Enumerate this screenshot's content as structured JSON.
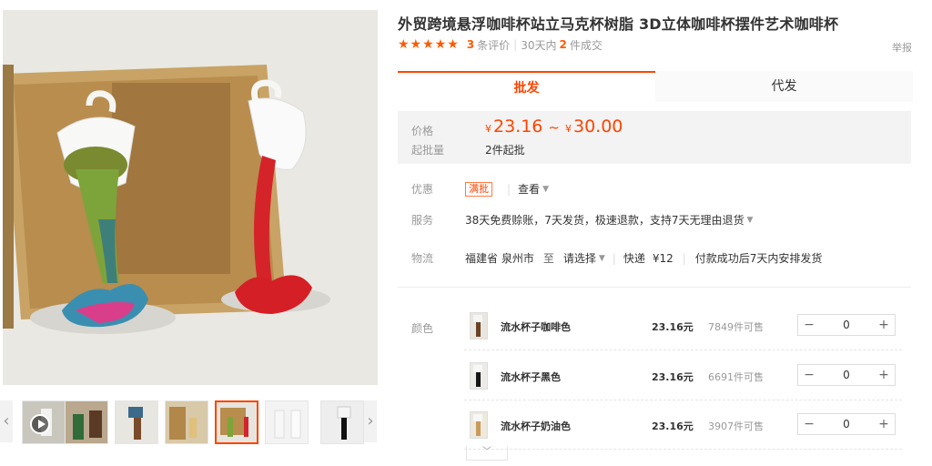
{
  "product": {
    "title": "外贸跨境悬浮咖啡杯站立马克杯树脂 3D立体咖啡杯摆件艺术咖啡杯",
    "stars": "★★★★★",
    "review_count": "3",
    "review_label": "条评价",
    "sales_prefix": "30天内",
    "sales_count": "2",
    "sales_label": "件成交",
    "report": "举报"
  },
  "tabs": [
    {
      "label": "批发"
    },
    {
      "label": "代发"
    }
  ],
  "price": {
    "label": "价格",
    "currency": "¥",
    "low": "23.16",
    "tilde": "~",
    "high": "30.00",
    "min_label": "起批量",
    "min_value": "2件起批"
  },
  "promo": {
    "label": "优惠",
    "tag": "满批",
    "view": "查看"
  },
  "service": {
    "label": "服务",
    "text": "38天免费赊账，7天发货，极速退款，支持7天无理由退货"
  },
  "logistics": {
    "label": "物流",
    "from": "福建省 泉州市",
    "to": "至",
    "select": "请选择",
    "express": "快递",
    "fee": "¥12",
    "ship_note": "付款成功后7天内安排发货"
  },
  "color_label": "颜色",
  "skus": [
    {
      "name": "流水杯子咖啡色",
      "price": "23.16元",
      "stock": "7849件可售",
      "qty": "0"
    },
    {
      "name": "流水杯子黑色",
      "price": "23.16元",
      "stock": "6691件可售",
      "qty": "0"
    },
    {
      "name": "流水杯子奶油色",
      "price": "23.16元",
      "stock": "3907件可售",
      "qty": "0"
    }
  ],
  "stepper": {
    "minus": "−",
    "plus": "+"
  },
  "arrows": {
    "left": "‹",
    "right": "›",
    "more": "﹀"
  }
}
